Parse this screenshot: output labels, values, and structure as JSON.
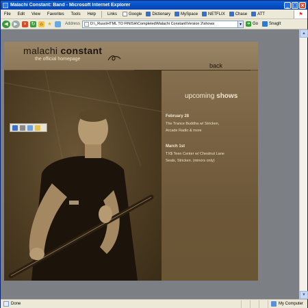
{
  "window": {
    "title": "Malachi Constant: Band - Microsoft Internet Explorer",
    "minimize": "_",
    "maximize": "□",
    "close": "×"
  },
  "menu": {
    "items": [
      "File",
      "Edit",
      "View",
      "Favorites",
      "Tools",
      "Help"
    ],
    "links_label": "Links",
    "links": [
      {
        "label": "Google",
        "icon": "google-icon",
        "color": "#ffffff"
      },
      {
        "label": "Dictionary",
        "icon": "dictionary-icon",
        "color": "#3a6fc9"
      },
      {
        "label": "MySpace",
        "icon": "myspace-icon",
        "color": "#3a6fc9"
      },
      {
        "label": "NETFLIX",
        "icon": "netflix-icon",
        "color": "#3a6fc9"
      },
      {
        "label": "Chase",
        "icon": "chase-icon",
        "color": "#3a6fc9"
      },
      {
        "label": "ATT",
        "icon": "att-icon",
        "color": "#3a6fc9"
      }
    ]
  },
  "address": {
    "label": "Address",
    "url": "D:\\_Russ\\HTML TO FINISH\\Completed\\Malachi Constant\\Version 2\\shows",
    "go_label": "Go",
    "snagit_label": "SnagIt"
  },
  "site": {
    "brand_light": "malachi ",
    "brand_bold": "constant",
    "tagline": "the official homepage",
    "back_label": "back",
    "shows_title_light": "upcoming ",
    "shows_title_bold": "shows",
    "shows": [
      {
        "date": "February 28",
        "line1": "The Trance Buddha w/ Stricken,",
        "line2": "Arcade Radio & more"
      },
      {
        "date": "March 1st",
        "line1": "TX$ Teen Center w/ Chestnut Lane",
        "line2": "Seals, Stricken. (minors only)"
      }
    ]
  },
  "status": {
    "text": "Done",
    "zone": "My Computer"
  },
  "colors": {
    "sepia_dark": "#3a2c17",
    "sepia_light": "#f2e6d0",
    "titlebar": "#0a5fd8"
  }
}
